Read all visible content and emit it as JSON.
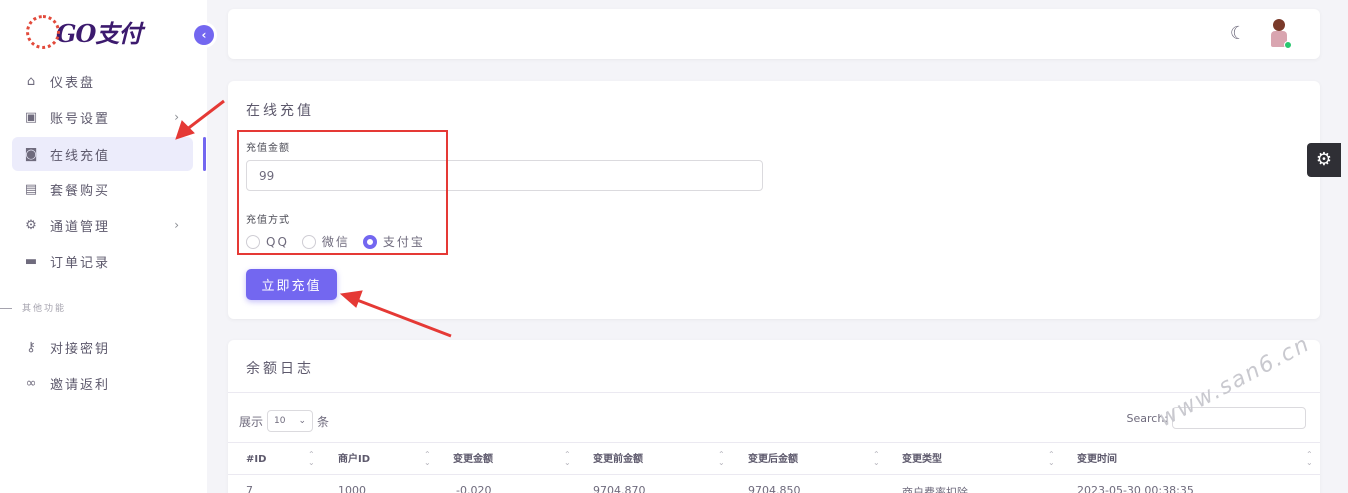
{
  "brand": {
    "logo_text": "GO支付",
    "accent": "#7367f0"
  },
  "sidebar": {
    "items": [
      {
        "label": "仪表盘",
        "icon": "home-icon"
      },
      {
        "label": "账号设置",
        "icon": "profile-icon",
        "has_children": true
      },
      {
        "label": "在线充值",
        "icon": "wallet-icon",
        "active": true
      },
      {
        "label": "套餐购买",
        "icon": "bag-icon"
      },
      {
        "label": "通道管理",
        "icon": "gear-icon",
        "has_children": true
      },
      {
        "label": "订单记录",
        "icon": "card-icon"
      }
    ],
    "section_label": "其他功能",
    "extra_items": [
      {
        "label": "对接密钥",
        "icon": "key-icon"
      },
      {
        "label": "邀请返利",
        "icon": "link-icon"
      }
    ]
  },
  "recharge": {
    "title": "在线充值",
    "amount_label": "充值金额",
    "amount_value": "99",
    "method_label": "充值方式",
    "methods": [
      {
        "label": "QQ",
        "checked": false
      },
      {
        "label": "微信",
        "checked": false
      },
      {
        "label": "支付宝",
        "checked": true
      }
    ],
    "submit_label": "立即充值"
  },
  "log": {
    "title": "余额日志",
    "show_prefix": "展示",
    "page_size": "10",
    "show_suffix": "条",
    "search_label": "Search:",
    "columns": [
      "#ID",
      "商户ID",
      "变更金额",
      "变更前金额",
      "变更后金额",
      "变更类型",
      "变更时间"
    ],
    "rows": [
      [
        "7",
        "1000",
        "-0.020",
        "9704.870",
        "9704.850",
        "商户费率扣除",
        "2023-05-30 00:38:35"
      ]
    ]
  },
  "watermark": "www.san6.cn"
}
